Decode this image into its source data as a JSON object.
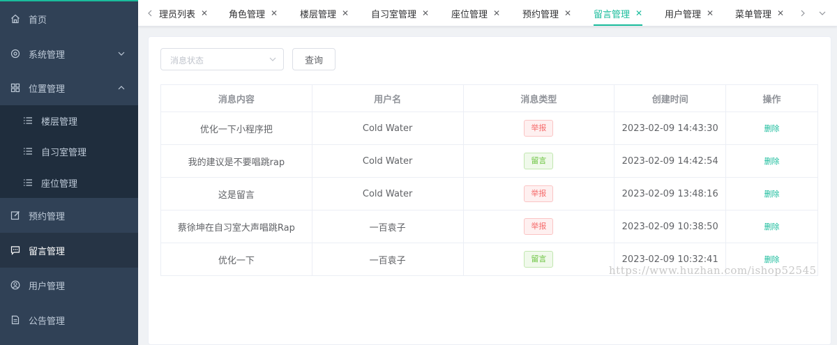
{
  "sidebar": {
    "items": [
      {
        "label": "首页",
        "icon": "home-icon"
      },
      {
        "label": "系统管理",
        "icon": "gear-icon",
        "expanded": false
      },
      {
        "label": "位置管理",
        "icon": "grid-icon",
        "expanded": true
      },
      {
        "label": "预约管理",
        "icon": "edit-icon"
      },
      {
        "label": "留言管理",
        "icon": "chat-icon",
        "active": true
      },
      {
        "label": "用户管理",
        "icon": "user-icon"
      },
      {
        "label": "公告管理",
        "icon": "document-icon"
      }
    ],
    "sub_items": [
      {
        "label": "楼层管理",
        "icon": "list-icon"
      },
      {
        "label": "自习室管理",
        "icon": "list-icon"
      },
      {
        "label": "座位管理",
        "icon": "list-icon"
      }
    ]
  },
  "tags": [
    {
      "label": "理员列表"
    },
    {
      "label": "角色管理"
    },
    {
      "label": "楼层管理"
    },
    {
      "label": "自习室管理"
    },
    {
      "label": "座位管理"
    },
    {
      "label": "预约管理"
    },
    {
      "label": "留言管理",
      "active": true
    },
    {
      "label": "用户管理"
    },
    {
      "label": "菜单管理"
    }
  ],
  "filter": {
    "status_placeholder": "消息状态",
    "query_label": "查询"
  },
  "table": {
    "headers": [
      "消息内容",
      "用户名",
      "消息类型",
      "创建时间",
      "操作"
    ],
    "rows": [
      {
        "content": "优化一下小程序把",
        "user": "Cold Water",
        "type": "举报",
        "type_kind": "report",
        "time": "2023-02-09 14:43:30",
        "action": "删除"
      },
      {
        "content": "我的建议是不要唱跳rap",
        "user": "Cold Water",
        "type": "留言",
        "type_kind": "msg",
        "time": "2023-02-09 14:42:54",
        "action": "删除"
      },
      {
        "content": "这是留言",
        "user": "Cold Water",
        "type": "举报",
        "type_kind": "report",
        "time": "2023-02-09 13:48:16",
        "action": "删除"
      },
      {
        "content": "蔡徐坤在自习室大声唱跳Rap",
        "user": "一百袁子",
        "type": "举报",
        "type_kind": "report",
        "time": "2023-02-09 10:38:50",
        "action": "删除"
      },
      {
        "content": "优化一下",
        "user": "一百袁子",
        "type": "留言",
        "type_kind": "msg",
        "time": "2023-02-09 10:32:41",
        "action": "删除"
      }
    ]
  },
  "watermark": "https://www.huzhan.com/ishop52545",
  "colors": {
    "sidebar_bg": "#304156",
    "accent": "#1abc9c",
    "report": "#f56c6c",
    "message": "#67c23a"
  }
}
